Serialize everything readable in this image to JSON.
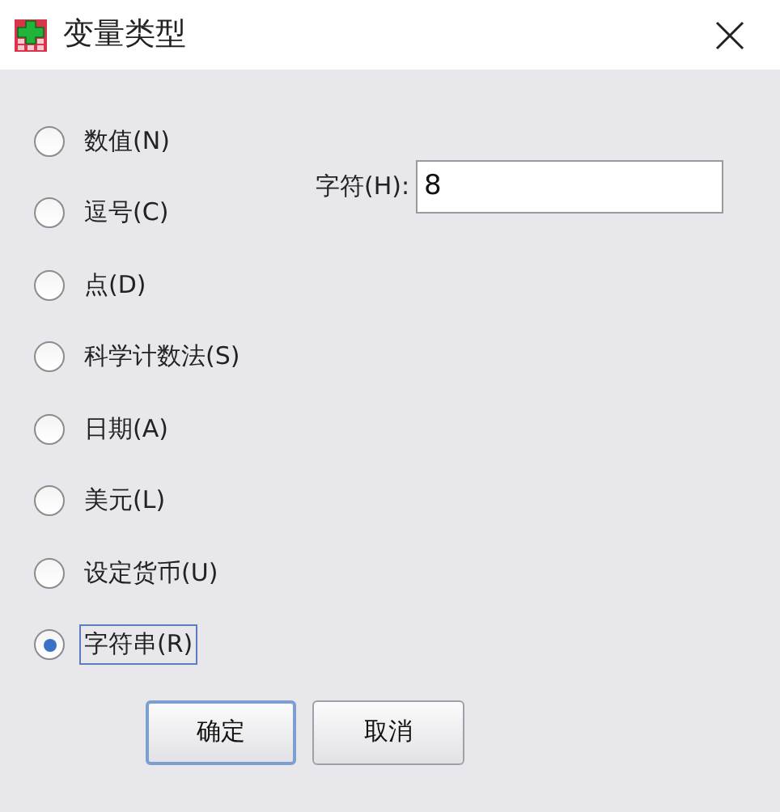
{
  "window": {
    "title": "变量类型"
  },
  "types": [
    {
      "label": "数值(N)",
      "selected": false
    },
    {
      "label": "逗号(C)",
      "selected": false
    },
    {
      "label": "点(D)",
      "selected": false
    },
    {
      "label": "科学计数法(S)",
      "selected": false
    },
    {
      "label": "日期(A)",
      "selected": false
    },
    {
      "label": "美元(L)",
      "selected": false
    },
    {
      "label": "设定货币(U)",
      "selected": false
    },
    {
      "label": "字符串(R)",
      "selected": true
    }
  ],
  "characters": {
    "label": "字符(H):",
    "value": "8"
  },
  "buttons": [
    {
      "label": "确定",
      "default": true
    },
    {
      "label": "取消",
      "default": false
    }
  ]
}
